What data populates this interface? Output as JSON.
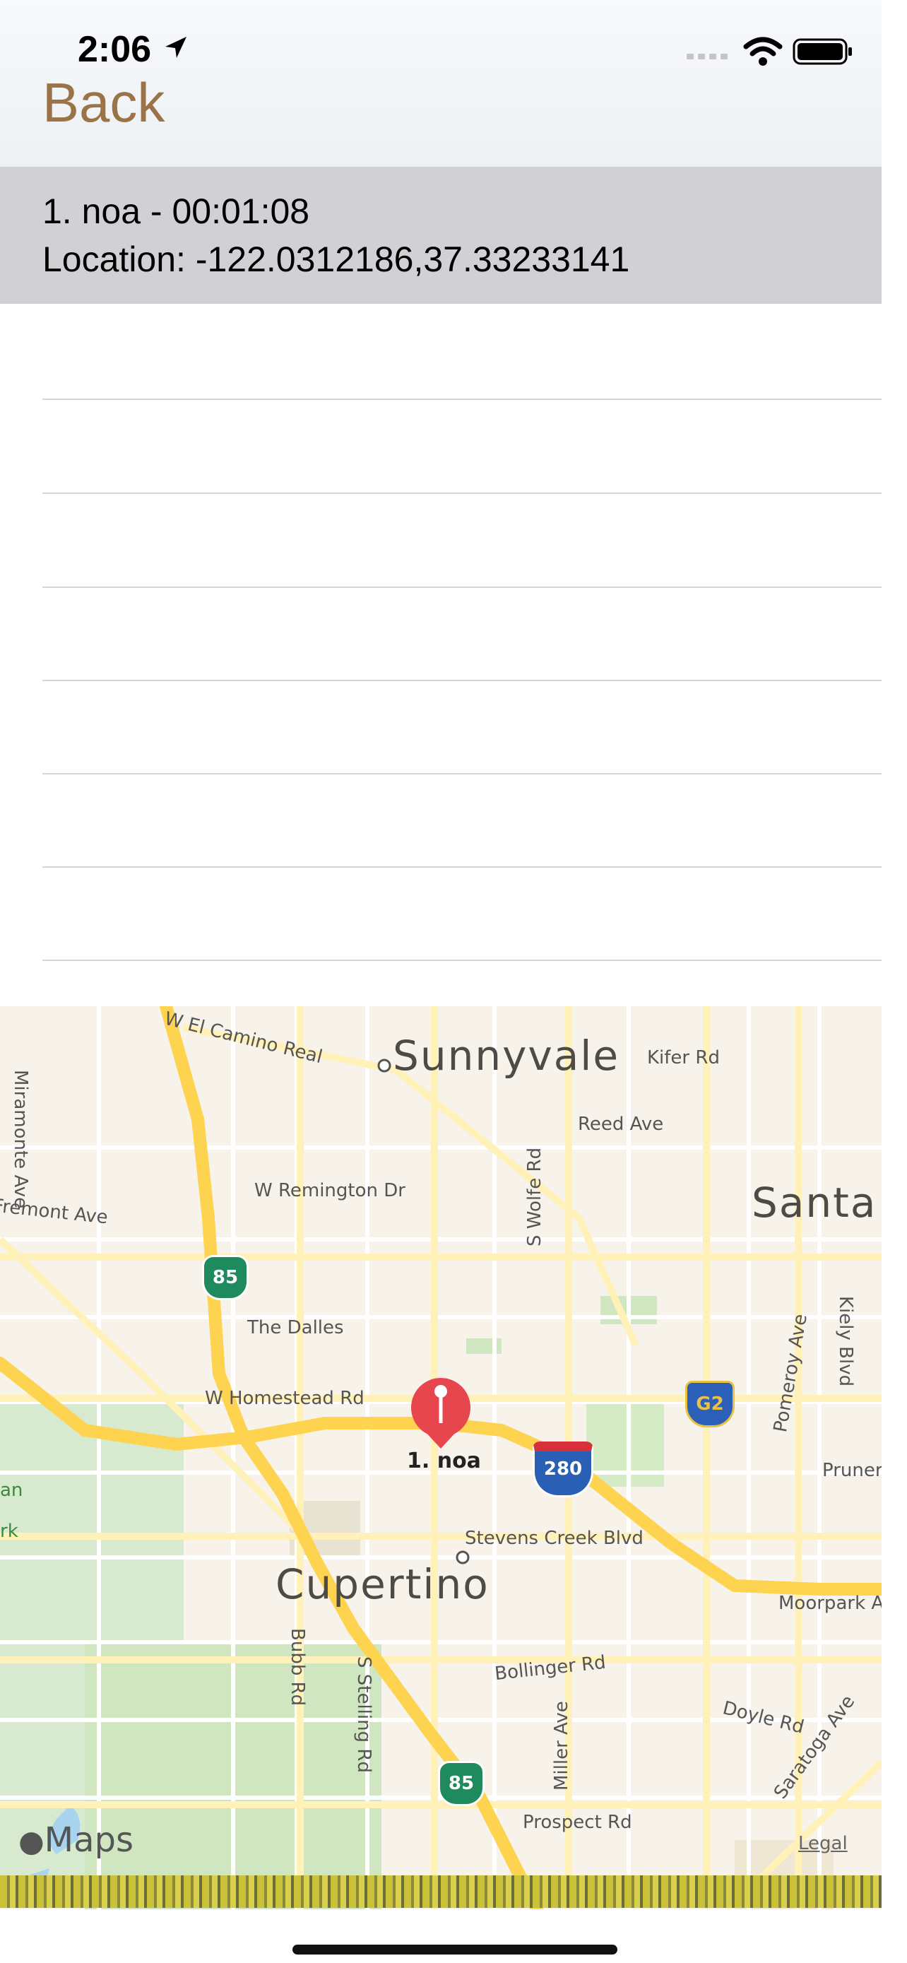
{
  "status_bar": {
    "time": "2:06",
    "location_icon": "location-arrow-icon",
    "signal_icon": "signal-icon",
    "wifi_icon": "wifi-icon",
    "battery_icon": "battery-icon"
  },
  "nav": {
    "back_label": "Back"
  },
  "list": {
    "selected_item": {
      "title": "1. noa - 00:01:08",
      "location": "Location: -122.0312186,37.33233141"
    },
    "empty_rows": 7
  },
  "map": {
    "pin_label": "1. noa",
    "cities": [
      "Sunnyvale",
      "Santa",
      "Cupertino"
    ],
    "streets": {
      "el_camino": "W El Camino Real",
      "kifer": "Kifer Rd",
      "reed": "Reed Ave",
      "remington": "W Remington Dr",
      "wolfe": "S Wolfe Rd",
      "miramonte": "Miramonte Ave",
      "fremont": "Fremont Ave",
      "dalles": "The Dalles",
      "homestead": "W Homestead Rd",
      "pomeroy": "Pomeroy Ave",
      "kiely": "Kiely Blvd",
      "pruneridge": "Pruner",
      "stevens_creek": "Stevens Creek Blvd",
      "moorpark": "Moorpark Av",
      "bubb": "Bubb Rd",
      "stelling": "S Stelling Rd",
      "bollinger": "Bollinger Rd",
      "miller": "Miller Ave",
      "doyle": "Doyle Rd",
      "saratoga": "Saratoga Ave",
      "prospect": "Prospect Rd",
      "park_an": "an",
      "park_rk": "rk"
    },
    "shields": {
      "hwy85_a": "85",
      "hwy85_b": "85",
      "i280": "280",
      "g2": "G2"
    },
    "maps_brand": "Maps",
    "legal_label": "Legal",
    "colors": {
      "background": "#f7f2ea",
      "highway": "#fdd34f",
      "road": "#fff3c2",
      "park": "#cfe6c0",
      "water": "#a8d4f0",
      "pin": "#e8464f"
    }
  }
}
